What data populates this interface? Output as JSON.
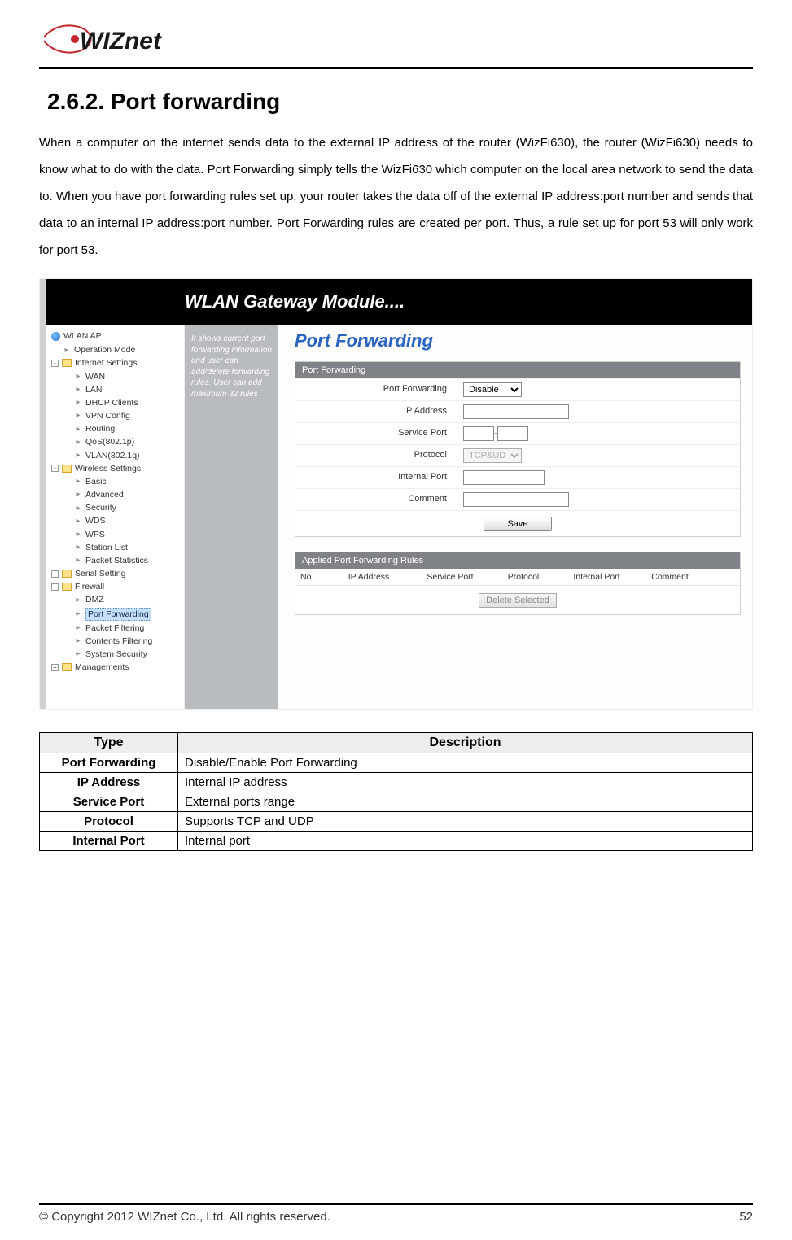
{
  "logo_text": "WIZnet",
  "section_title": "2.6.2.  Port  forwarding",
  "paragraph": "When a computer on the internet sends data to the external IP address of the router (WizFi630), the router (WizFi630) needs to know what to do with the data. Port Forwarding simply tells the WizFi630 which computer on the local area network to send the data to. When you have port forwarding rules set up, your router takes the data off of the external IP address:port number and sends that data to an internal IP address:port number. Port Forwarding rules are created per port. Thus, a rule set up for port 53 will only work for port 53.",
  "screenshot": {
    "window_title": "WLAN Gateway Module....",
    "help_text": "It shows current port forwarding information and user can add/delete forwarding rules. User can add maximum 32 rules",
    "tree": {
      "root": "WLAN AP",
      "op_mode": "Operation Mode",
      "internet_settings": "Internet Settings",
      "internet_children": [
        "WAN",
        "LAN",
        "DHCP Clients",
        "VPN Config",
        "Routing",
        "QoS(802.1p)",
        "VLAN(802.1q)"
      ],
      "wireless_settings": "Wireless Settings",
      "wireless_children": [
        "Basic",
        "Advanced",
        "Security",
        "WDS",
        "WPS",
        "Station List",
        "Packet Statistics"
      ],
      "serial_setting": "Serial Setting",
      "firewall": "Firewall",
      "firewall_children": [
        "DMZ",
        "Port Forwarding",
        "Packet Filtering",
        "Contents Filtering",
        "System Security"
      ],
      "managements": "Managements"
    },
    "page_title": "Port Forwarding",
    "box1_header": "Port Forwarding",
    "labels": {
      "port_forwarding": "Port Forwarding",
      "ip_address": "IP Address",
      "service_port": "Service Port",
      "protocol": "Protocol",
      "internal_port": "Internal Port",
      "comment": "Comment"
    },
    "values": {
      "port_forwarding_select": "Disable",
      "protocol_select": "TCP&UDP",
      "service_port_dash": "-"
    },
    "save_button": "Save",
    "box2_header": "Applied Port Forwarding Rules",
    "rule_headers": [
      "No.",
      "IP Address",
      "Service Port",
      "Protocol",
      "Internal Port",
      "Comment"
    ],
    "delete_button": "Delete Selected"
  },
  "table": {
    "header_type": "Type",
    "header_desc": "Description",
    "rows": [
      {
        "type": "Port Forwarding",
        "desc": "Disable/Enable Port Forwarding"
      },
      {
        "type": "IP Address",
        "desc": "Internal IP address"
      },
      {
        "type": "Service Port",
        "desc": "External ports range"
      },
      {
        "type": "Protocol",
        "desc": "Supports TCP and UDP"
      },
      {
        "type": "Internal Port",
        "desc": "Internal port"
      }
    ]
  },
  "footer": {
    "copyright": "© Copyright 2012 WIZnet Co., Ltd. All rights reserved.",
    "page_num": "52"
  }
}
